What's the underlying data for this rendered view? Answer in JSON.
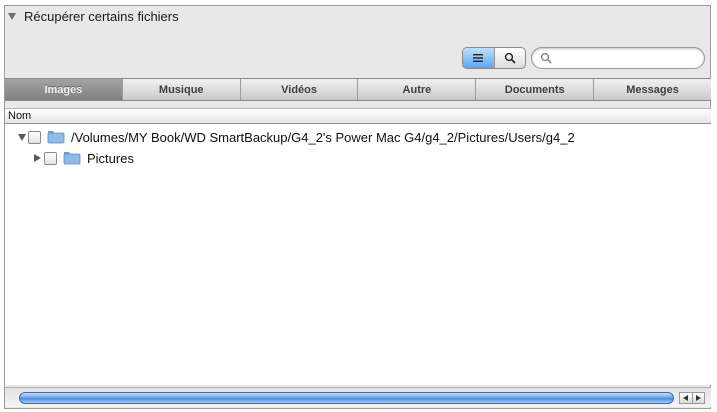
{
  "section": {
    "title": "Récupérer certains fichiers",
    "icon": "disclosure-triangle-down-icon"
  },
  "toolbar": {
    "list_view_icon": "list-view-icon",
    "search_view_icon": "magnifier-icon",
    "search": {
      "value": "",
      "placeholder": "",
      "icon": "search-icon"
    }
  },
  "tabs": [
    {
      "label": "Images",
      "active": true
    },
    {
      "label": "Musique",
      "active": false
    },
    {
      "label": "Vidéos",
      "active": false
    },
    {
      "label": "Autre",
      "active": false
    },
    {
      "label": "Documents",
      "active": false
    },
    {
      "label": "Messages",
      "active": false
    }
  ],
  "outline": {
    "column_header": "Nom",
    "rows": [
      {
        "label": "/Volumes/MY Book/WD SmartBackup/G4_2's Power Mac G4/g4_2/Pictures/Users/g4_2",
        "expanded": true,
        "checked": false,
        "icon": "folder-icon"
      },
      {
        "label": "Pictures",
        "expanded": false,
        "checked": false,
        "icon": "folder-icon"
      }
    ]
  },
  "colors": {
    "accent": "#4a8cdb",
    "folder": "#7fb0e3",
    "tab_active": "#8c8c8c"
  }
}
